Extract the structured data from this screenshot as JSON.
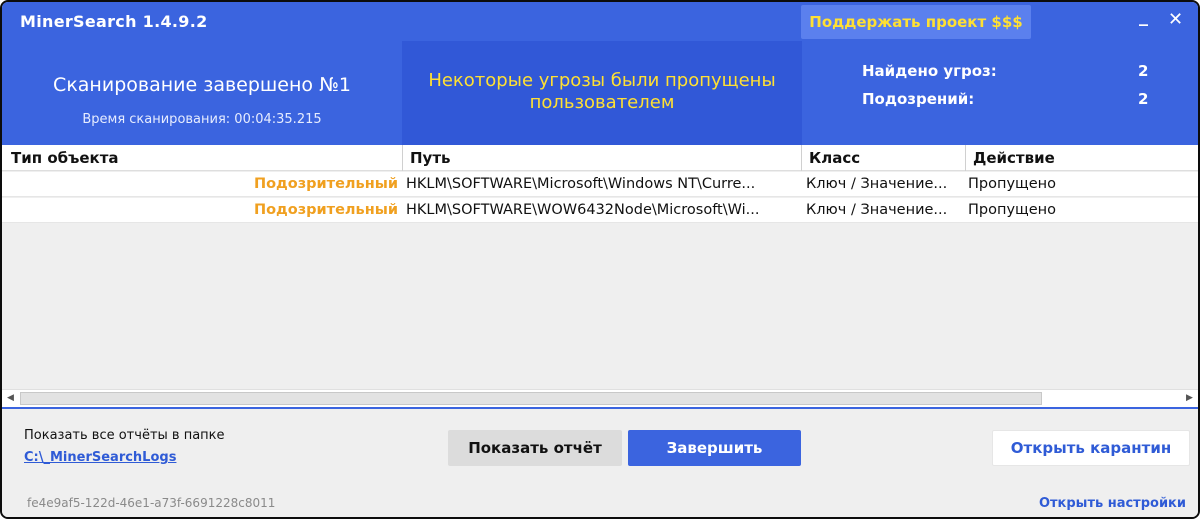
{
  "window": {
    "title": "MinerSearch 1.4.9.2",
    "support_label": "Поддержать проект $$$",
    "minimize_glyph": "_",
    "close_glyph": "✕"
  },
  "header": {
    "scan_title": "Сканирование завершено №1",
    "scan_time": "Время сканирования: 00:04:35.215",
    "status_message": "Некоторые угрозы были пропущены пользователем",
    "threats_label": "Найдено угроз:",
    "threats_value": "2",
    "suspicious_label": "Подозрений:",
    "suspicious_value": "2"
  },
  "table": {
    "columns": [
      "Тип объекта",
      "Путь",
      "Класс",
      "Действие"
    ],
    "rows": [
      {
        "type": "Подозрительный",
        "path": "HKLM\\SOFTWARE\\Microsoft\\Windows NT\\Curre...",
        "class": "Ключ / Значение...",
        "action": "Пропущено"
      },
      {
        "type": "Подозрительный",
        "path": "HKLM\\SOFTWARE\\WOW6432Node\\Microsoft\\Wi...",
        "class": "Ключ / Значение...",
        "action": "Пропущено"
      }
    ]
  },
  "footer": {
    "reports_label": "Показать все отчёты в папке",
    "reports_path": "C:\\_MinerSearchLogs",
    "show_report_label": "Показать отчёт",
    "finish_label": "Завершить",
    "quarantine_label": "Открыть карантин",
    "session_id": "fe4e9af5-122d-46e1-a73f-6691228c8011",
    "settings_label": "Открыть настройки"
  },
  "colors": {
    "accent": "#3b64df",
    "warning_text": "#ffe033",
    "suspicious_text": "#f0a020",
    "link": "#2f5bd6"
  }
}
